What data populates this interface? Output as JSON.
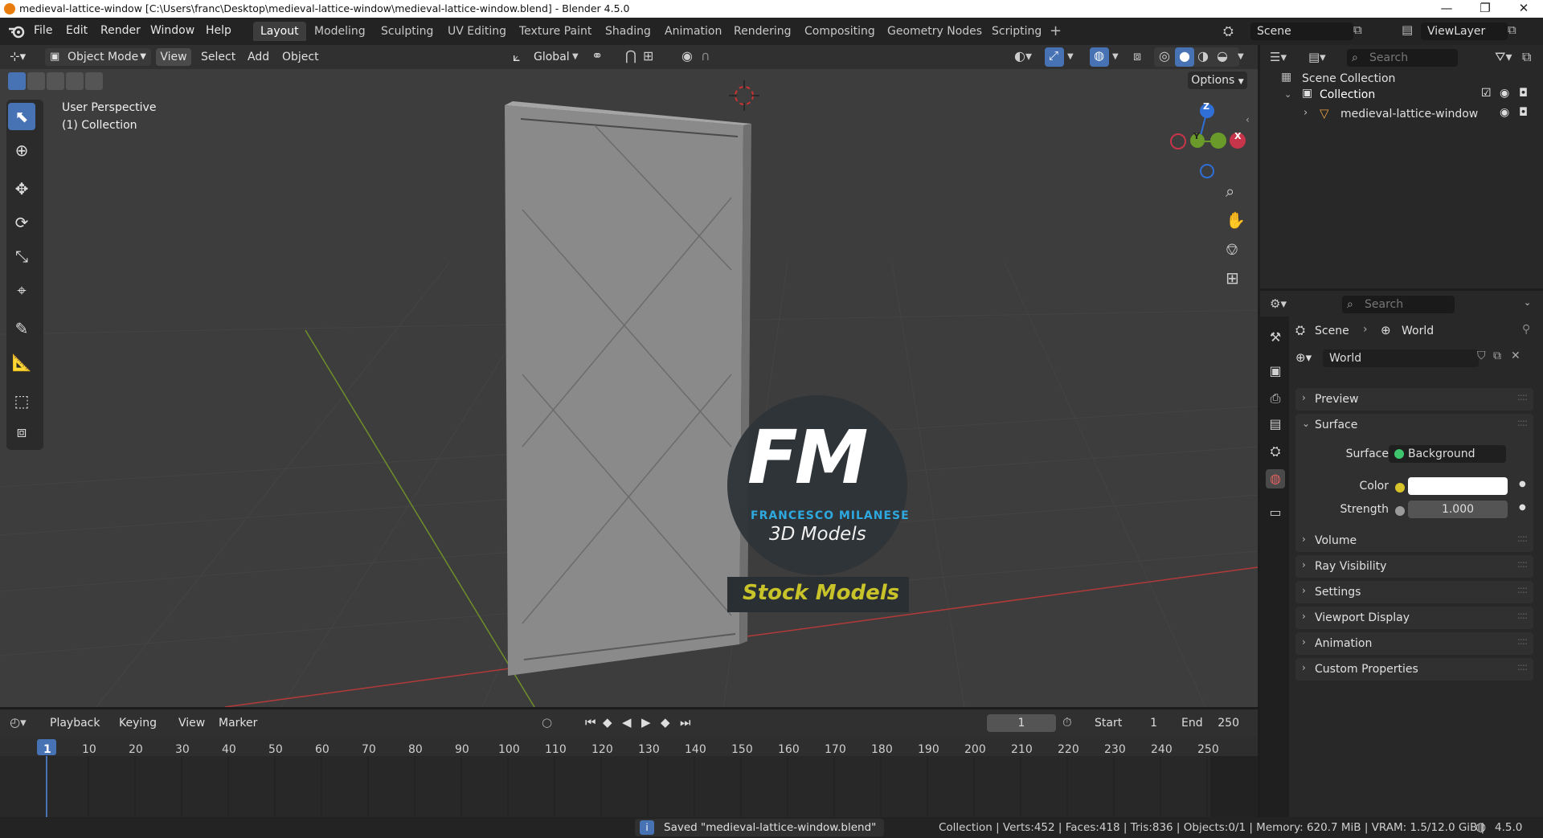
{
  "window": {
    "title": "medieval-lattice-window [C:\\Users\\franc\\Desktop\\medieval-lattice-window\\medieval-lattice-window.blend] - Blender 4.5.0",
    "minimize": "—",
    "restore": "❐",
    "close": "✕"
  },
  "menubar": {
    "menus": [
      "File",
      "Edit",
      "Render",
      "Window",
      "Help"
    ],
    "workspaces": [
      "Layout",
      "Modeling",
      "Sculpting",
      "UV Editing",
      "Texture Paint",
      "Shading",
      "Animation",
      "Rendering",
      "Compositing",
      "Geometry Nodes",
      "Scripting"
    ],
    "add_workspace": "+",
    "scene": "Scene",
    "view_layer": "ViewLayer"
  },
  "viewport_header": {
    "mode": "Object Mode",
    "menus": [
      "View",
      "Select",
      "Add",
      "Object"
    ],
    "transform_orientation": "Global",
    "options": "Options"
  },
  "viewport": {
    "perspective_label": "User Perspective",
    "collection_label": "(1) Collection",
    "gizmo_axes": {
      "z": "Z",
      "y": "Y",
      "x": "X"
    },
    "watermark": {
      "monogram": "FM",
      "author": "FRANCESCO MILANESE",
      "tagline": "3D Models",
      "banner": "Stock Models"
    },
    "colors": {
      "background": "#3d3d3d",
      "x_axis": "#b33a3a",
      "y_axis": "#6e8f2a",
      "selected_tool": "#4772b3"
    }
  },
  "outliner": {
    "search_placeholder": "Search",
    "scene_collection": "Scene Collection",
    "collection": "Collection",
    "object": "medieval-lattice-window"
  },
  "properties": {
    "search_placeholder": "Search",
    "breadcrumb": [
      "Scene",
      "World"
    ],
    "world_name": "World",
    "panels_top": [
      "Preview"
    ],
    "surface_panel": "Surface",
    "surface_label": "Surface",
    "surface_value": "Background",
    "color_label": "Color",
    "color_value": "#ffffff",
    "strength_label": "Strength",
    "strength_value": "1.000",
    "panels_bottom": [
      "Volume",
      "Ray Visibility",
      "Settings",
      "Viewport Display",
      "Animation",
      "Custom Properties"
    ]
  },
  "timeline": {
    "menus": [
      "Playback",
      "Keying",
      "View",
      "Marker"
    ],
    "current_frame": "1",
    "start_label": "Start",
    "start_value": "1",
    "end_label": "End",
    "end_value": "250",
    "ticks": [
      "1",
      "10",
      "20",
      "30",
      "40",
      "50",
      "60",
      "70",
      "80",
      "90",
      "100",
      "110",
      "120",
      "130",
      "140",
      "150",
      "160",
      "170",
      "180",
      "190",
      "200",
      "210",
      "220",
      "230",
      "240",
      "250"
    ]
  },
  "statusbar": {
    "message": "Saved \"medieval-lattice-window.blend\"",
    "stats": "Collection | Verts:452 | Faces:418 | Tris:836 | Objects:0/1 | Memory: 620.7 MiB | VRAM: 1.5/12.0 GiB |",
    "version": "4.5.0"
  }
}
